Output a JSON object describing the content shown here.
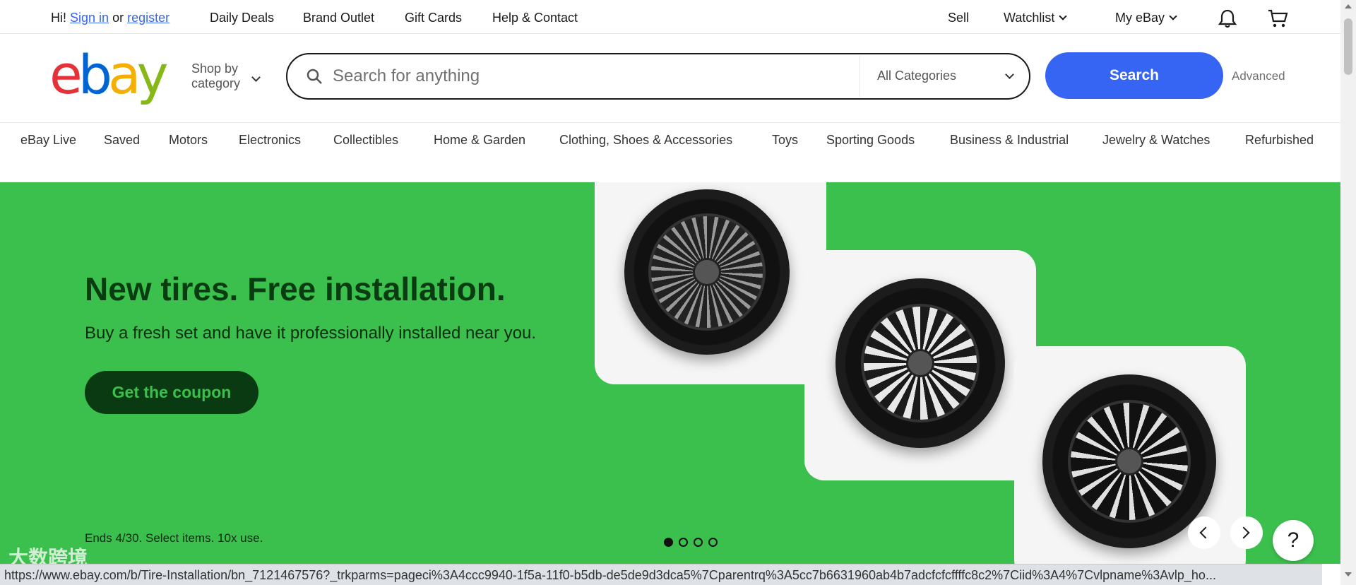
{
  "topbar": {
    "greeting": "Hi!",
    "sign_in": "Sign in",
    "or": "or",
    "register": "register",
    "links": [
      "Daily Deals",
      "Brand Outlet",
      "Gift Cards",
      "Help & Contact"
    ],
    "sell": "Sell",
    "watchlist": "Watchlist",
    "my_ebay": "My eBay"
  },
  "header": {
    "logo": [
      "e",
      "b",
      "a",
      "y"
    ],
    "logo_colors": [
      "#e53238",
      "#0064d2",
      "#f5af02",
      "#86b817"
    ],
    "shop_by_line1": "Shop by",
    "shop_by_line2": "category",
    "search_placeholder": "Search for anything",
    "category_select": "All Categories",
    "search_button": "Search",
    "advanced": "Advanced"
  },
  "categories": [
    "eBay Live",
    "Saved",
    "Motors",
    "Electronics",
    "Collectibles",
    "Home & Garden",
    "Clothing, Shoes & Accessories",
    "Toys",
    "Sporting Goods",
    "Business & Industrial",
    "Jewelry & Watches",
    "Refurbished"
  ],
  "hero": {
    "title": "New tires. Free installation.",
    "subtitle": "Buy a fresh set and have it professionally installed near you.",
    "cta": "Get the coupon",
    "fineprint": "Ends 4/30. Select items. 10x use.",
    "background_color": "#3cc04d",
    "slide_count": 4,
    "active_slide": 1,
    "help": "?"
  },
  "statusbar": {
    "url": "https://www.ebay.com/b/Tire-Installation/bn_7121467576?_trkparms=pageci%3A4ccc9940-1f5a-11f0-b5db-de5de9d3dca5%7Cparentrq%3A5cc7b6631960ab4b7adcfcfcffffc8c2%7Ciid%3A4%7Cvlpname%3Avlp_ho..."
  },
  "watermark": "大数跨境"
}
